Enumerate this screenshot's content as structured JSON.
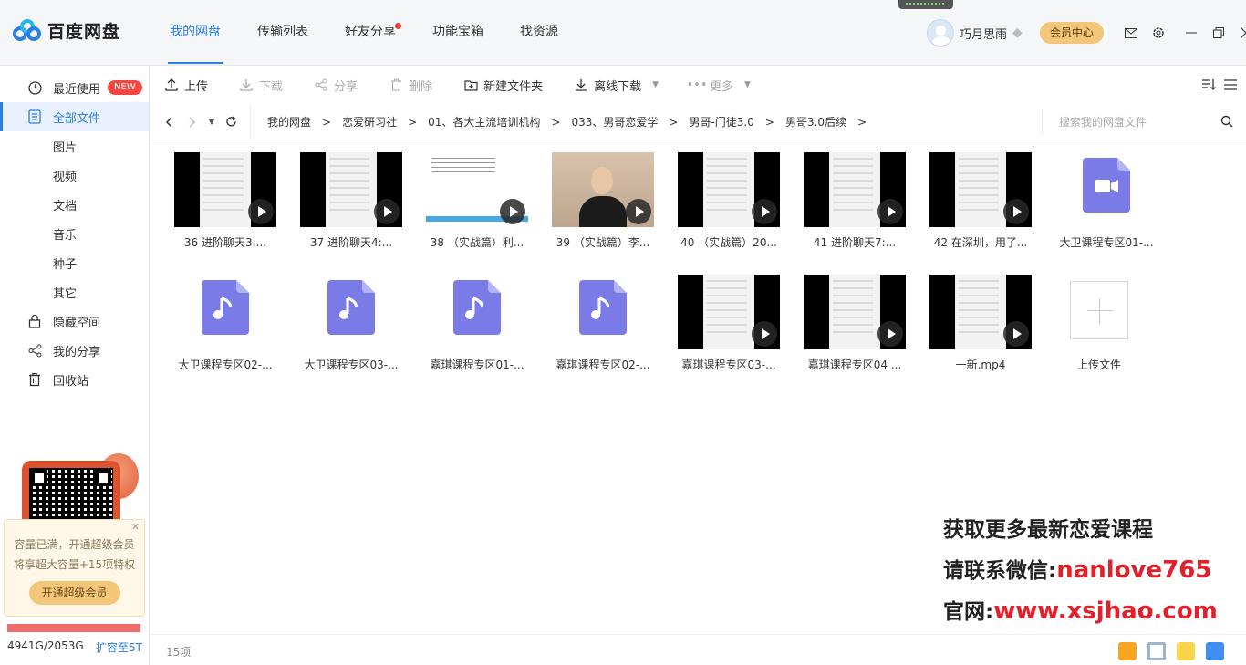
{
  "app": {
    "name": "百度网盘",
    "colors": {
      "accent": "#2b7ee3",
      "vip": "#f3c67a",
      "danger": "#f2463f",
      "file_icon": "#7b7be8"
    }
  },
  "nav": {
    "tabs": [
      {
        "label": "我的网盘",
        "active": true
      },
      {
        "label": "传输列表"
      },
      {
        "label": "好友分享",
        "dot": true
      },
      {
        "label": "功能宝箱"
      },
      {
        "label": "找资源"
      }
    ]
  },
  "user": {
    "name": "巧月思雨",
    "vip_center": "会员中心"
  },
  "sidebar": {
    "items": [
      {
        "label": "最近使用",
        "icon": "clock-icon",
        "badge": "NEW"
      },
      {
        "label": "全部文件",
        "icon": "file-list-icon",
        "active": true
      },
      {
        "label": "图片",
        "sub": true
      },
      {
        "label": "视频",
        "sub": true
      },
      {
        "label": "文档",
        "sub": true
      },
      {
        "label": "音乐",
        "sub": true
      },
      {
        "label": "种子",
        "sub": true
      },
      {
        "label": "其它",
        "sub": true
      },
      {
        "label": "隐藏空间",
        "icon": "lock-icon"
      },
      {
        "label": "我的分享",
        "icon": "share-icon"
      },
      {
        "label": "回收站",
        "icon": "trash-icon"
      }
    ],
    "capacity_card": {
      "line1": "容量已满，开通超级会员",
      "line2": "将享超大容量+15项特权",
      "button": "开通超级会员"
    },
    "usage": {
      "text": "4941G/2053G",
      "expand": "扩容至5T",
      "fill": 1.0
    }
  },
  "toolbar": {
    "upload": "上传",
    "download": "下载",
    "share": "分享",
    "delete": "删除",
    "new_folder": "新建文件夹",
    "offline": "离线下载",
    "more": "更多"
  },
  "breadcrumb": {
    "items": [
      "我的网盘",
      "恋爱研习社",
      "01、各大主流培训机构",
      "033、男哥恋爱学",
      "男哥-门徒3.0",
      "男哥3.0后续"
    ],
    "separator": ">"
  },
  "search": {
    "placeholder": "搜索我的网盘文件"
  },
  "files": [
    {
      "name": "36 进阶聊天3:...",
      "type": "video",
      "thumb": "phone"
    },
    {
      "name": "37 进阶聊天4:...",
      "type": "video",
      "thumb": "phone"
    },
    {
      "name": "38 （实战篇）利...",
      "type": "video",
      "thumb": "screen"
    },
    {
      "name": "39 （实战篇）李...",
      "type": "video",
      "thumb": "person"
    },
    {
      "name": "40 （实战篇）20...",
      "type": "video",
      "thumb": "phone"
    },
    {
      "name": "41 进阶聊天7:...",
      "type": "video",
      "thumb": "phone"
    },
    {
      "name": "42 在深圳，用了...",
      "type": "video",
      "thumb": "phone"
    },
    {
      "name": "大卫课程专区01-...",
      "type": "video-file"
    },
    {
      "name": "大卫课程专区02-...",
      "type": "audio"
    },
    {
      "name": "大卫课程专区03-...",
      "type": "audio"
    },
    {
      "name": "嘉琪课程专区01-...",
      "type": "audio"
    },
    {
      "name": "嘉琪课程专区02-...",
      "type": "audio"
    },
    {
      "name": "嘉琪课程专区03-...",
      "type": "video",
      "thumb": "phone"
    },
    {
      "name": "嘉琪课程专区04 ...",
      "type": "video",
      "thumb": "phone"
    },
    {
      "name": "一新.mp4",
      "type": "video",
      "thumb": "phone"
    },
    {
      "name": "上传文件",
      "type": "upload"
    }
  ],
  "watermark": {
    "line1": "获取更多最新恋爱课程",
    "line2_label": "请联系微信:",
    "line2_value": "nanlove765",
    "line3_label": "官网:",
    "line3_value": "www.xsjhao.com"
  },
  "status": {
    "count": "15项"
  }
}
